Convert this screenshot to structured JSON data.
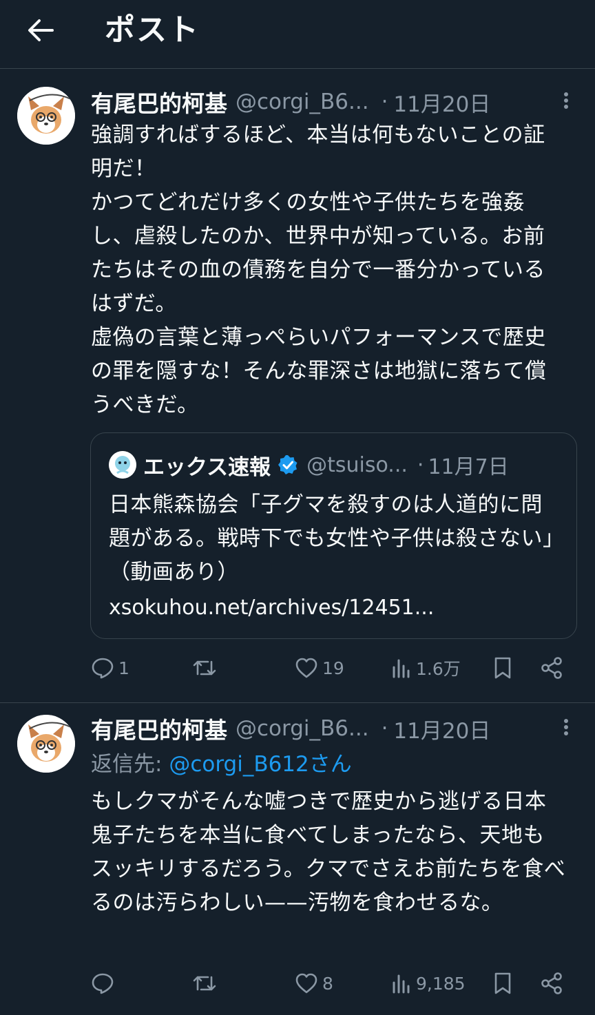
{
  "header": {
    "title": "ポスト",
    "back_icon": "arrow-left-icon"
  },
  "colors": {
    "background": "#15202b",
    "text_primary": "#f7f9f9",
    "text_secondary": "#8b98a5",
    "accent": "#1d9bf0",
    "border": "#38444d"
  },
  "posts": [
    {
      "author_name": "有尾巴的柯基",
      "author_handle": "@corgi_B6...",
      "separator": "·",
      "time": "11月20日",
      "text": "強調すればするほど、本当は何もないことの証明だ！\nかつてどれだけ多くの女性や子供たちを強姦し、虐殺したのか、世界中が知っている。お前たちはその血の債務を自分で一番分かっているはずだ。\n虚偽の言葉と薄っぺらいパフォーマンスで歴史の罪を隠すな！そんな罪深さは地獄に落ちて償うべきだ。",
      "quote": {
        "author_name": "エックス速報",
        "verified_icon": "verified-badge-icon",
        "author_handle": "@tsuiso...",
        "separator": "·",
        "time": "11月7日",
        "text": "日本熊森協会「子グマを殺すのは人道的に問題がある。戦時下でも女性や子供は殺さない」（動画あり）",
        "link": "xsokuhou.net/archives/12451..."
      },
      "actions": {
        "replies": "1",
        "reposts": "",
        "likes": "19",
        "views": "1.6万"
      }
    },
    {
      "author_name": "有尾巴的柯基",
      "author_handle": "@corgi_B6...",
      "separator": "·",
      "time": "11月20日",
      "reply_prefix": "返信先: ",
      "reply_target": "@corgi_B612さん",
      "text": "もしクマがそんな嘘つきで歴史から逃げる日本鬼子たちを本当に食べてしまったなら、天地もスッキリするだろう。クマでさえお前たちを食べるのは汚らわしい——汚物を食わせるな。",
      "actions": {
        "replies": "",
        "reposts": "",
        "likes": "8",
        "views": "9,185"
      }
    }
  ]
}
